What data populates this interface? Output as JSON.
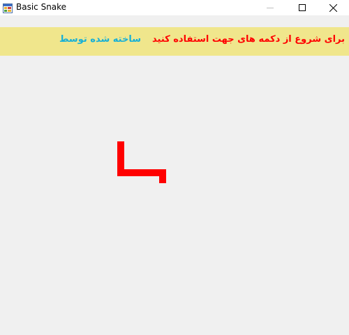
{
  "window": {
    "title": "Basic Snake",
    "app_icon": "app-window-icon",
    "controls": {
      "minimize_icon": "minimize-icon",
      "maximize_icon": "maximize-icon",
      "close_icon": "close-icon"
    }
  },
  "info_bar": {
    "instructions": "برای شروع از دکمه های جهت استفاده کنید",
    "credits": "ساخته شده توسط",
    "background_color": "#f0e68c",
    "instructions_color": "#ff0000",
    "credits_color": "#17b0d6"
  },
  "game": {
    "snake_color": "#ff0000",
    "board_color": "#f0f0f0"
  }
}
